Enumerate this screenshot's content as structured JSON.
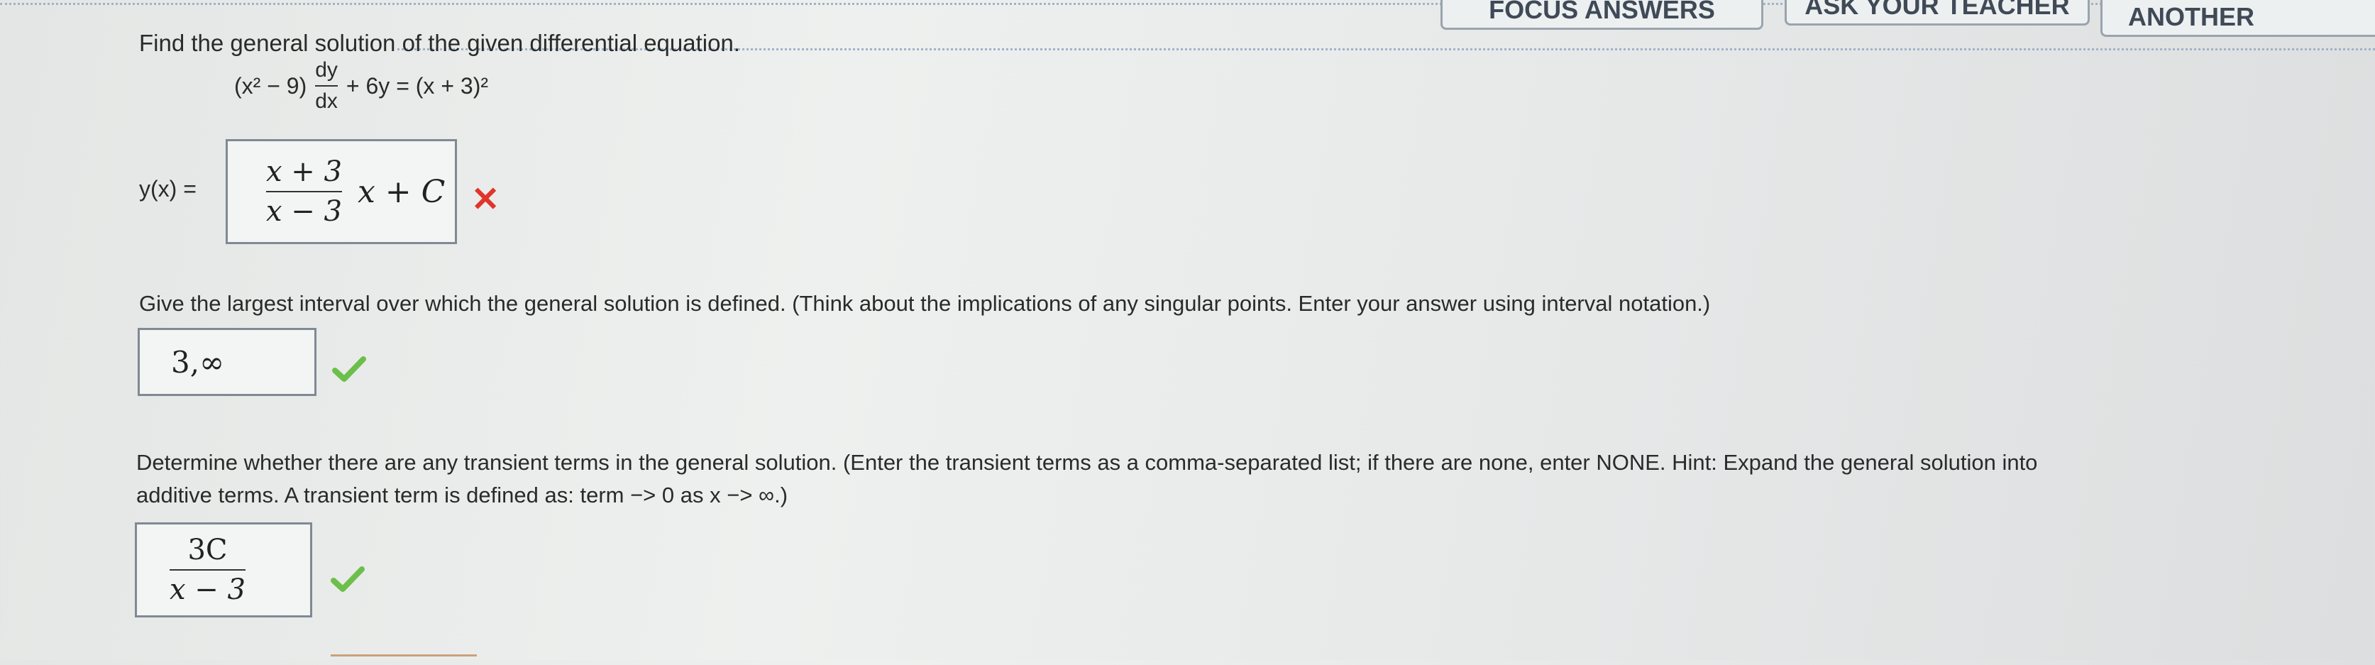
{
  "header": {
    "buttons": [
      {
        "label": "FOCUS ANSWERS"
      },
      {
        "label": "ASK YOUR TEACHER"
      },
      {
        "label": "PRACTICE ANOTHER"
      }
    ]
  },
  "question": {
    "prompt": "Find the general solution of the given differential equation.",
    "equation": {
      "left_factor": "(x² − 9)",
      "deriv_num": "dy",
      "deriv_den": "dx",
      "right_side": "+ 6y = (x + 3)²"
    }
  },
  "part1": {
    "label": "y(x) =",
    "answer": {
      "numerator": "x + 3",
      "denominator": "x − 3",
      "tail": "x + C"
    },
    "status": "incorrect"
  },
  "part2": {
    "prompt": "Give the largest interval over which the general solution is defined. (Think about the implications of any singular points. Enter your answer using interval notation.)",
    "answer": "3,∞",
    "status": "correct"
  },
  "part3": {
    "prompt_line1": "Determine whether there are any transient terms in the general solution. (Enter the transient terms as a comma-separated list; if there are none, enter NONE.   Hint: Expand the general solution into",
    "prompt_line2": "additive terms. A transient term is defined as: term −> 0 as x −> ∞.)",
    "answer": {
      "numerator": "3C",
      "denominator": "x − 3"
    },
    "status": "correct"
  },
  "colors": {
    "correct": "#6cbf4a",
    "incorrect": "#e0352b"
  }
}
